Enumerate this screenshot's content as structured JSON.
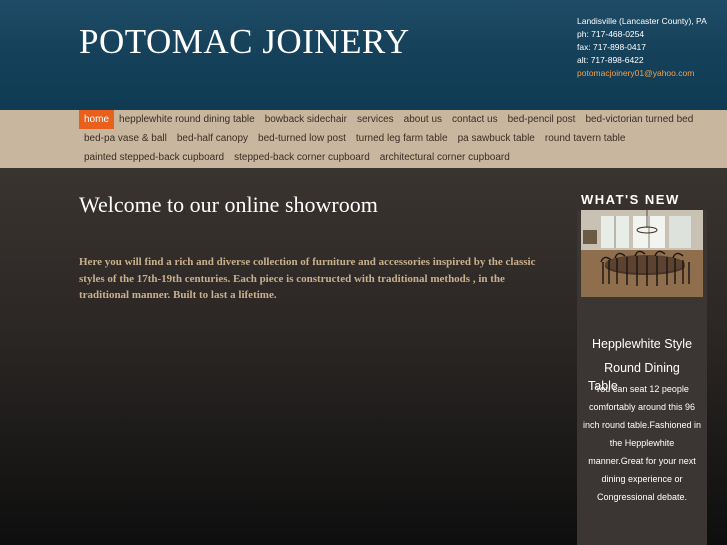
{
  "header": {
    "site_title": "POTOMAC JOINERY",
    "contact": {
      "location": "Landisville (Lancaster County), PA",
      "phone": "ph: 717-468-0254",
      "fax": "fax: 717-898-0417",
      "alt": "alt: 717-898-6422",
      "email": "potomacjoinery01@yahoo.com"
    }
  },
  "nav": {
    "row1": [
      "home",
      "hepplewhite round dining table",
      "bowback sidechair",
      "services",
      "about us",
      "contact us",
      "bed-pencil post",
      "bed-victorian turned bed"
    ],
    "row2": [
      "bed-pa vase & ball",
      "bed-half canopy",
      "bed-turned low post",
      "turned leg farm table",
      "pa sawbuck table",
      "round tavern table"
    ],
    "row3": [
      "painted stepped-back cupboard",
      "stepped-back corner cupboard",
      "architectural corner cupboard"
    ]
  },
  "main": {
    "title": "Welcome to our online showroom",
    "intro": "Here you will find a rich and diverse collection of furniture and accessories inspired by the classic styles of the 17th-19th centuries. Each piece is constructed with traditional methods , in the traditional manner. Built to last a lifetime."
  },
  "sidebar": {
    "title": "WHAT'S NEW",
    "heading_line1": "Hepplewhite Style",
    "heading_line2": "Round Dining",
    "heading_line3": "Table",
    "body": "You can seat 12 people comfortably around this 96 inch round table.Fashioned in the Hepplewhite manner.Great for your next dining experience or Congressional debate."
  },
  "colors": {
    "header_blue": "#17425c",
    "nav_tan": "#c8b69e",
    "active_orange": "#e8601c",
    "intro_text": "#c9b08c",
    "email": "#f2a24a"
  }
}
